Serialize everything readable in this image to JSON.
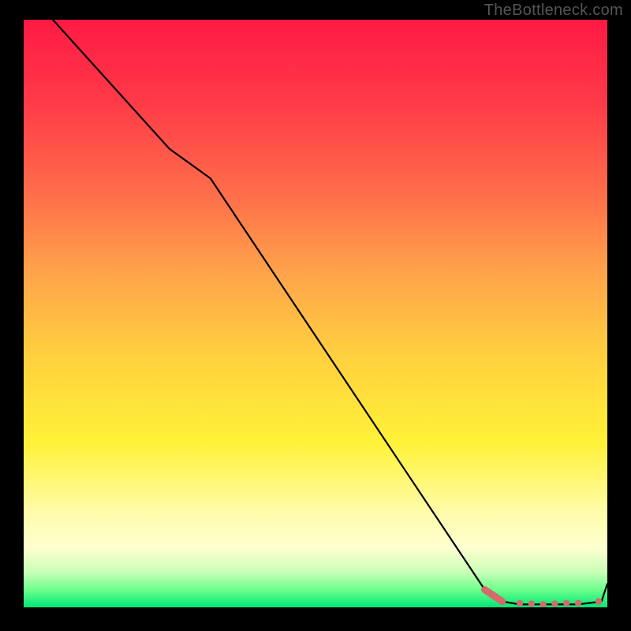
{
  "watermark": "TheBottleneck.com",
  "chart_data": {
    "type": "line",
    "title": "",
    "xlabel": "",
    "ylabel": "",
    "xlim": [
      0,
      100
    ],
    "ylim": [
      0,
      100
    ],
    "series": [
      {
        "name": "bottleneck-curve",
        "x": [
          0,
          5,
          25,
          32,
          79,
          82,
          85,
          90,
          95,
          99,
          100
        ],
        "values": [
          108,
          100,
          78,
          73,
          3,
          1,
          0.5,
          0.5,
          0.5,
          1,
          4
        ]
      }
    ],
    "markers": [
      {
        "name": "flat-segment-marker",
        "x": 82,
        "y": 1
      },
      {
        "name": "flat-segment-marker",
        "x": 85,
        "y": 0.7
      },
      {
        "name": "flat-segment-marker",
        "x": 87,
        "y": 0.6
      },
      {
        "name": "flat-segment-marker",
        "x": 89,
        "y": 0.5
      },
      {
        "name": "flat-segment-marker",
        "x": 91,
        "y": 0.6
      },
      {
        "name": "flat-segment-marker",
        "x": 93,
        "y": 0.7
      },
      {
        "name": "flat-segment-marker",
        "x": 95,
        "y": 0.7
      },
      {
        "name": "flat-segment-marker",
        "x": 98.5,
        "y": 1
      }
    ],
    "gradient_stops": [
      {
        "pos": 0,
        "color": "#ff1a44"
      },
      {
        "pos": 14,
        "color": "#ff3a48"
      },
      {
        "pos": 30,
        "color": "#ff6f4a"
      },
      {
        "pos": 44,
        "color": "#ffa74a"
      },
      {
        "pos": 58,
        "color": "#ffd23e"
      },
      {
        "pos": 72,
        "color": "#fff238"
      },
      {
        "pos": 84,
        "color": "#fffcac"
      },
      {
        "pos": 90,
        "color": "#fdffd0"
      },
      {
        "pos": 94,
        "color": "#c9ffb6"
      },
      {
        "pos": 97,
        "color": "#6eff8c"
      },
      {
        "pos": 100,
        "color": "#00e676"
      }
    ],
    "colors": {
      "curve": "#000000",
      "marker": "#d46a6a",
      "frame_bg": "#000000"
    }
  }
}
